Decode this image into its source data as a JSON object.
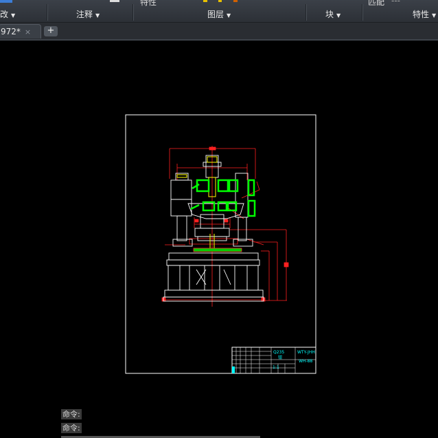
{
  "ribbon": {
    "top_partial": {
      "properties": "特性",
      "match": "匹配",
      "dashes": "---"
    },
    "panels": [
      {
        "label": "改"
      },
      {
        "label": "注释"
      },
      {
        "label": "图层"
      },
      {
        "label": "块"
      },
      {
        "label": "特性"
      }
    ]
  },
  "tabs": {
    "active": {
      "label": "972*",
      "close": "×"
    },
    "new_tab": "+"
  },
  "title_block": {
    "material": "Q235",
    "drawing_no": "WTY-JHH",
    "part": "钳",
    "scale_info": "1:1",
    "sheet": "WH-88"
  },
  "command_lines": [
    "命令:",
    "命令:"
  ],
  "colors": {
    "background": "#000000",
    "frame": "#ffffff",
    "dimension": "#ff0000",
    "highlight": "#00ff00",
    "text": "#00ffff"
  }
}
